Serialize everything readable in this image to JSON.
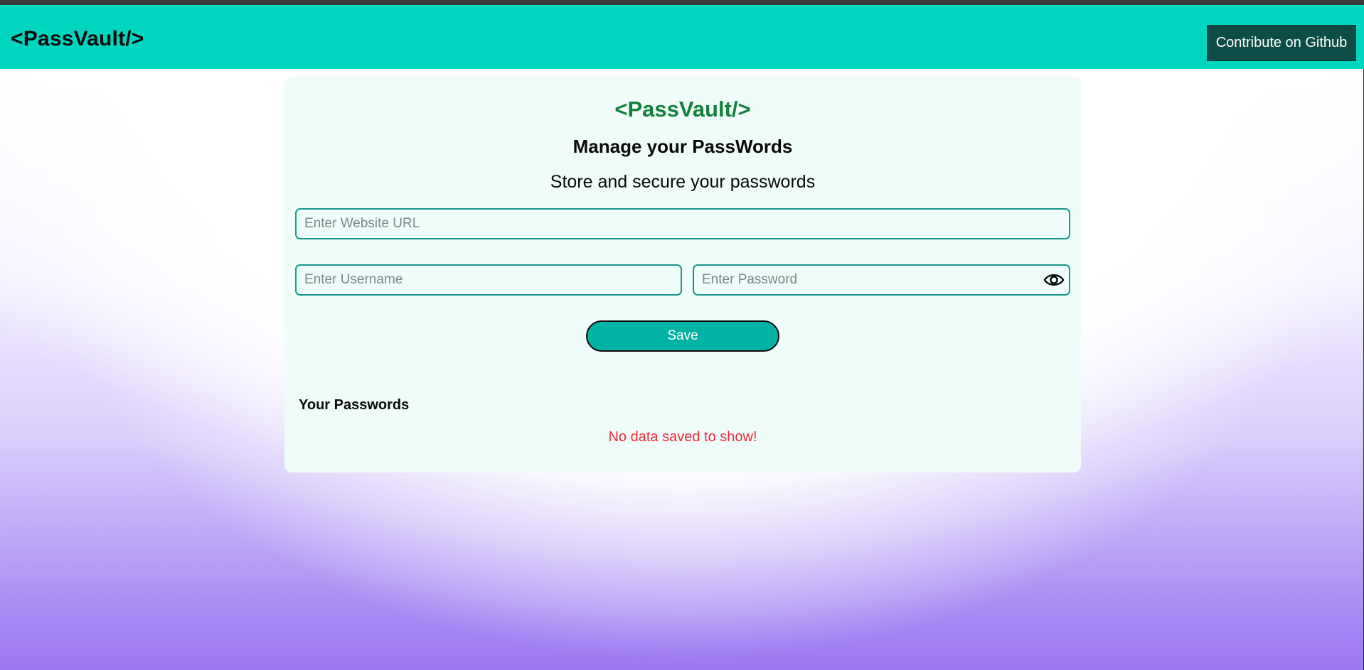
{
  "navbar": {
    "brand": "<PassVault/>",
    "github_button": "Contribute on Github"
  },
  "card": {
    "logo": "<PassVault/>",
    "heading": "Manage your PassWords",
    "subheading": "Store and secure your passwords"
  },
  "form": {
    "url_placeholder": "Enter Website URL",
    "url_value": "",
    "username_placeholder": "Enter Username",
    "username_value": "",
    "password_placeholder": "Enter Password",
    "password_value": "",
    "save_label": "Save",
    "eye_icon": "eye-icon"
  },
  "passwords": {
    "title": "Your Passwords",
    "empty_message": "No data saved to show!"
  },
  "colors": {
    "navbar": "#00d5c0",
    "github_button": "#0e4d47",
    "card_background": "#effcfa",
    "logo_green": "#15803d",
    "input_border": "#159a8c",
    "save_button": "#00b3a4",
    "empty_message": "#ef2b3a",
    "background_bottom": "#9b76f2"
  }
}
